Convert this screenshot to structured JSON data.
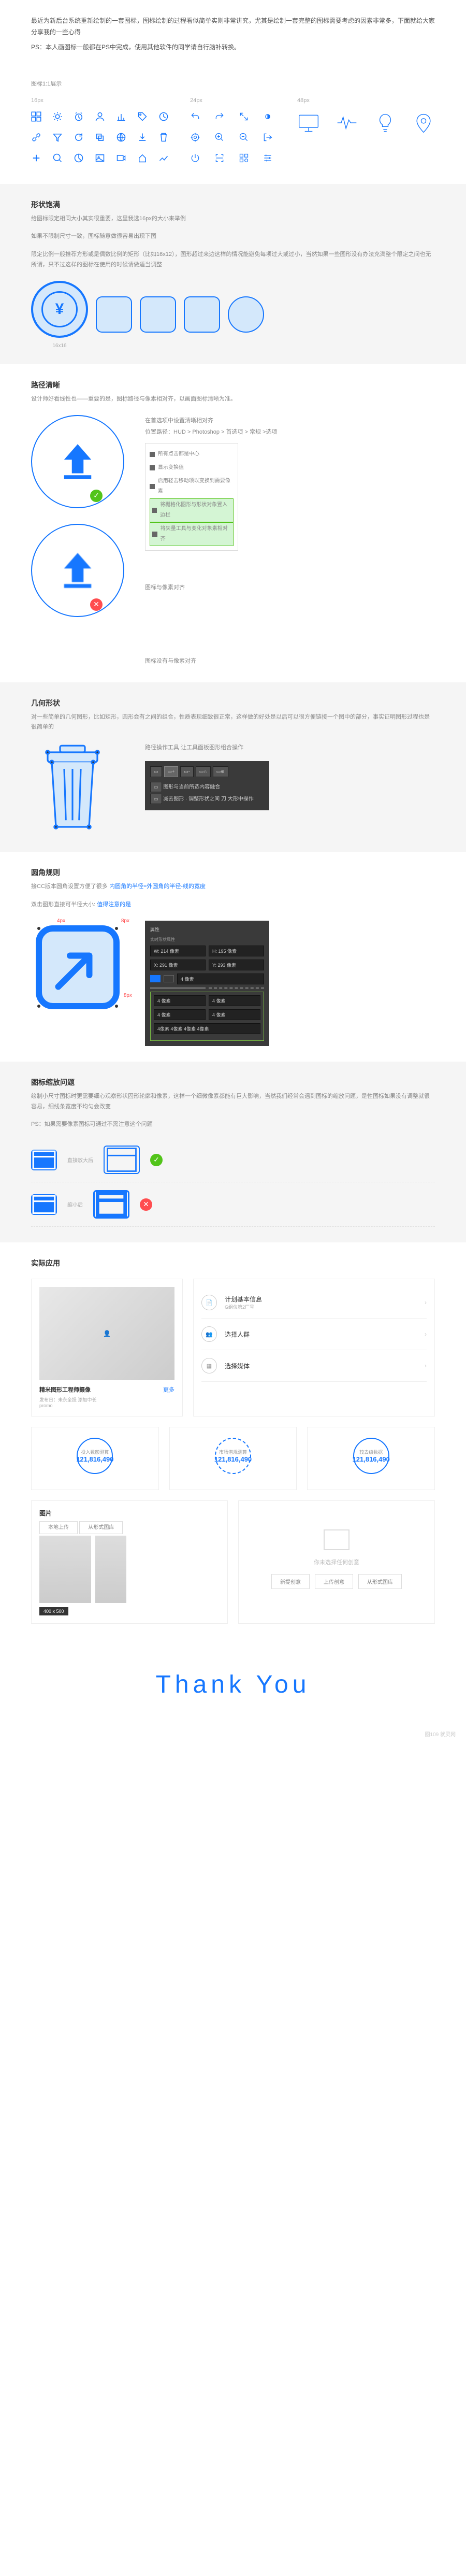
{
  "intro": {
    "p1": "最近为新后台系统重新绘制的一套图标，图标绘制的过程看似简单实则非常讲究，尤其是绘制一套完整的图标需要考虑的因素非常多，下面就给大家分享我的一些心得",
    "p2": "PS：本人画图标一般都在PS中完成，使用其他软件的同学请自行脑补转换。"
  },
  "showcase": {
    "title": "图标1:1展示",
    "c1": "16px",
    "c2": "24px",
    "c3": "48px"
  },
  "s1": {
    "title": "形状饱满",
    "d1": "给图标限定相同大小其实很重要，这里我选16px的大小来举例",
    "d2": "如果不限制尺寸一致，图标随意做很容易出现下图",
    "d3": "限定比例一般推荐方形或是偶数比例的矩形（比如16x12），图形超过来边这样的情况能避免每项过大或过小，当然如果一些图形没有办法充满整个限定之间也无所谓，只不过这样的图标在使用的时候请做适当调整",
    "coin": "¥",
    "label": "16x16"
  },
  "s2": {
    "title": "路径清晰",
    "d1": "设计师好看线性也——重要的是，图标路径与像素相对齐，以画面图标清晰为准。",
    "n1": "在首选项中设置清晰相对齐",
    "n2": "位置路径：HUD > Photoshop > 首选项 > 常规 >选项",
    "t1": "所有点击都是中心",
    "t2": "显示变换值",
    "t3": "启用轻击移动项以变换到需要像素",
    "t4": "将栅格化图形与形状对象置入边栏",
    "t5": "将矢量工具与变化对象素相对齐",
    "m1": "图标与像素对齐",
    "m2": "图标没有与像素对齐"
  },
  "s3": {
    "title": "几何形状",
    "d1": "对一些简单的几何图形，比如矩形，圆形会有之间的组合，性质表现细致很正常，这样做的好处是以后可以很方便链接一个图中的部分，事实证明图形过程也是很简单的",
    "n1": "路径操作工具 让工具面板图形组合操作",
    "t1": "图形与当前所选内容融合",
    "t2": "减去图形 · 调整形状之间 刀 大形中操作"
  },
  "s4": {
    "title": "圆角规则",
    "d1": "接CC版本圆角设置方便了很多",
    "d2": "双击图形直接可半径大小:",
    "r1": "内圆角的半径=外圆角的半径-线的宽度",
    "r2": "值得注意的是",
    "l1": "4px",
    "l2": "8px",
    "props": {
      "t": "属性",
      "shape": "实时形状属性",
      "w": "W: 214 像素",
      "h": "H: 195 像素",
      "x": "X: 291 像素",
      "y": "Y: 293 像素",
      "stroke": "4 像素",
      "r1": "4 像素",
      "r2": "4 像素",
      "r3": "4 像素",
      "r4": "4 像素",
      "inner": "4像素 4像素 4像素 4像素"
    }
  },
  "s5": {
    "title": "图标缩放问题",
    "d1": "绘制小尺寸图标时更需要细心观察形状固形轮廓和像素，这样一个细微像素都能有巨大影响，当然我们经常会遇到图标的缩放问题，是性图标如果没有调整就很容易，细线条宽度不均匀会改变",
    "d2": "PS：如果需要像素图标可通过不需注意这个问题",
    "r1": "直接放大后",
    "r2": "缩小后"
  },
  "s6": {
    "title": "实际应用",
    "profile": {
      "name": "精米图形工程师摄像",
      "more": "更多",
      "date": "发布日：未永全提 添加中长",
      "author": "promo"
    },
    "steps": {
      "title": "计划基本信息",
      "sub": "G组位第2厂号",
      "s1": "选择人群",
      "s2": "选择媒体"
    },
    "m1": {
      "label": "投入数额测算",
      "value": "121,816,490"
    },
    "m2": {
      "label": "市场潜规测算",
      "value": "121,816,490"
    },
    "m3": {
      "label": "较去级数据",
      "value": "121,816,490"
    },
    "img": {
      "title": "图片",
      "b1": "本地上传",
      "b2": "从形式图库",
      "size": "400 x 500"
    },
    "empty": {
      "text": "你未选择任何创意",
      "b1": "新提创意",
      "b2": "上传创意",
      "b3": "从形式图库"
    }
  },
  "thanks": "Thank You",
  "watermark": "图109 就灵网"
}
